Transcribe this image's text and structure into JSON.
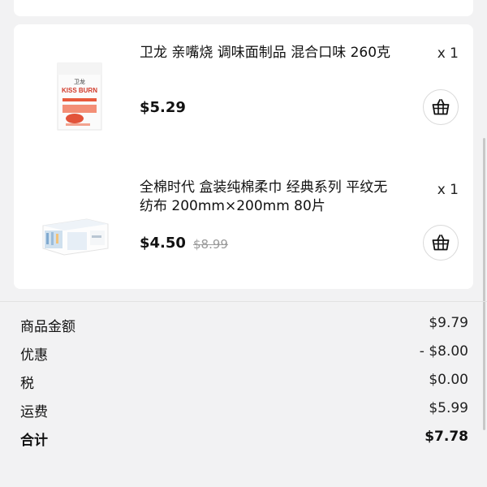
{
  "products": [
    {
      "title": "卫龙 亲嘴烧 调味面制品 混合口味 260克",
      "quantity": "x 1",
      "price": "$5.29",
      "image_icon": "snack-package-image",
      "image_logo_text": "KISS BURN"
    },
    {
      "title": "全棉时代 盒装纯棉柔巾 经典系列 平纹无纺布 200mm×200mm 80片",
      "quantity": "x 1",
      "price": "$4.50",
      "original_price": "$8.99",
      "image_icon": "tissue-box-image"
    }
  ],
  "summary": {
    "rows": [
      {
        "label": "商品金额",
        "value": "$9.79"
      },
      {
        "label": "优惠",
        "value": "- $8.00"
      },
      {
        "label": "税",
        "value": "$0.00"
      },
      {
        "label": "运费",
        "value": "$5.99"
      }
    ],
    "total": {
      "label": "合计",
      "value": "$7.78"
    }
  },
  "colors": {
    "background": "#f2f2f3",
    "card": "#ffffff",
    "strike": "#9a9a9a"
  }
}
